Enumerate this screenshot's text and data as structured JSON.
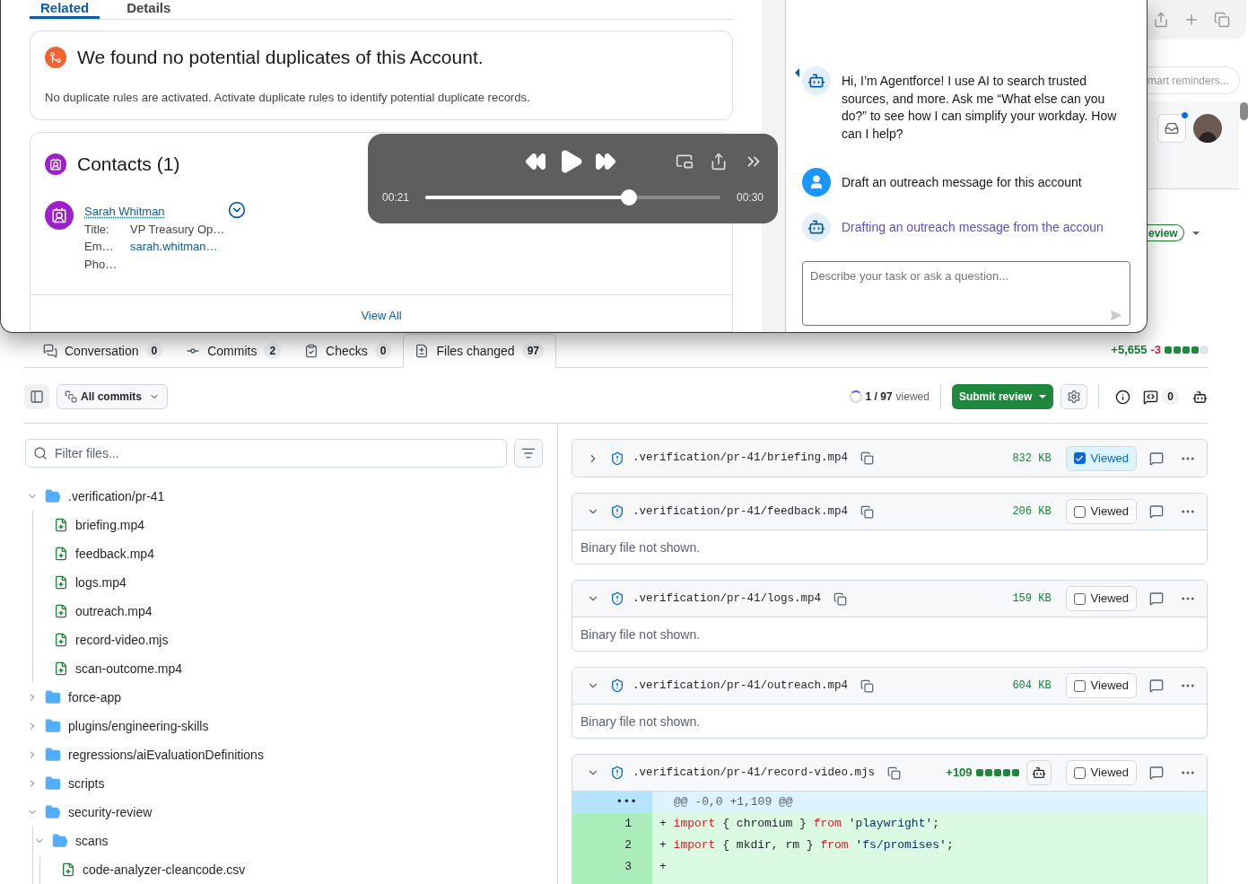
{
  "record_page": {
    "tabs": [
      {
        "label": "Related",
        "selected": true
      },
      {
        "label": "Details",
        "selected": false
      }
    ],
    "duplicates": {
      "title": "We found no potential duplicates of this Account.",
      "message": "No duplicate rules are activated. Activate duplicate rules to identify potential duplicate records."
    },
    "contacts": {
      "title": "Contacts (1)",
      "items": [
        {
          "name": "Sarah Whitman",
          "fields": [
            {
              "label": "Title:",
              "value": "VP Treasury Op…",
              "kind": "text"
            },
            {
              "label": "Em…",
              "value": "sarah.whitman…",
              "kind": "link"
            },
            {
              "label": "Pho…",
              "kind": "empty"
            }
          ]
        }
      ],
      "footer_link": "View All"
    }
  },
  "agent_panel": {
    "messages": [
      {
        "kind": "agent",
        "text": "Hi, I’m Agentforce! I use AI to search trusted sources, and more. Ask me “What else can you do?” to see how I can simplify your workday. How can I help?"
      },
      {
        "kind": "user",
        "text": "Draft an outreach message for this account"
      },
      {
        "kind": "agent_working",
        "text": "Drafting an outreach message from the accoun"
      }
    ],
    "input": {
      "placeholder": "Describe your task or ask a question..."
    }
  },
  "video_player": {
    "elapsed": "00:21",
    "duration": "00:30",
    "level": 0.69
  },
  "header_strip": {
    "search": {
      "placeholder": "mart reminders..."
    },
    "notifications": {
      "unread": true
    },
    "review_button": "eview"
  },
  "pr_tabs": [
    {
      "label": "Conversation",
      "count": "0",
      "selected": false
    },
    {
      "label": "Commits",
      "count": "2",
      "selected": false
    },
    {
      "label": "Checks",
      "count": "0",
      "selected": false
    },
    {
      "label": "Files changed",
      "count": "97",
      "selected": true
    }
  ],
  "diffstat": {
    "additions": "+5,655",
    "deletions": "-3",
    "blocks": [
      {
        "kind": "added"
      },
      {
        "kind": "added"
      },
      {
        "kind": "added"
      },
      {
        "kind": "added"
      },
      {
        "kind": "neutral"
      }
    ]
  },
  "toolbar": {
    "commits_menu": "All commits",
    "viewed_count": "1 / 97",
    "viewed_label": "viewed",
    "submit": "Submit review",
    "comments": "0"
  },
  "file_filter": {
    "placeholder": "Filter files..."
  },
  "file_tree": [
    {
      "kind": "folder",
      "name": ".verification/pr-41",
      "expanded": true,
      "children": [
        {
          "kind": "file",
          "name": "briefing.mp4"
        },
        {
          "kind": "file",
          "name": "feedback.mp4"
        },
        {
          "kind": "file",
          "name": "logs.mp4"
        },
        {
          "kind": "file",
          "name": "outreach.mp4"
        },
        {
          "kind": "file",
          "name": "record-video.mjs"
        },
        {
          "kind": "file",
          "name": "scan-outcome.mp4"
        }
      ]
    },
    {
      "kind": "folder",
      "name": "force-app",
      "expanded": false
    },
    {
      "kind": "folder",
      "name": "plugins/engineering-skills",
      "expanded": false
    },
    {
      "kind": "folder",
      "name": "regressions/aiEvaluationDefinitions",
      "expanded": false
    },
    {
      "kind": "folder",
      "name": "scripts",
      "expanded": false
    },
    {
      "kind": "folder",
      "name": "security-review",
      "expanded": true,
      "children": [
        {
          "kind": "folder",
          "name": "scans",
          "expanded": true,
          "children": [
            {
              "kind": "file",
              "name": "code-analyzer-cleancode.csv"
            }
          ]
        }
      ]
    }
  ],
  "diffs": [
    {
      "kind": "binary",
      "path": ".verification/pr-41/briefing.mp4",
      "size": "832 KB",
      "expanded": false,
      "viewed": true,
      "viewed_label": "Viewed"
    },
    {
      "kind": "binary",
      "path": ".verification/pr-41/feedback.mp4",
      "size": "206 KB",
      "expanded": true,
      "viewed": false,
      "viewed_label": "Viewed",
      "message": "Binary file not shown."
    },
    {
      "kind": "binary",
      "path": ".verification/pr-41/logs.mp4",
      "size": "159 KB",
      "expanded": true,
      "viewed": false,
      "viewed_label": "Viewed",
      "message": "Binary file not shown."
    },
    {
      "kind": "binary",
      "path": ".verification/pr-41/outreach.mp4",
      "size": "604 KB",
      "expanded": true,
      "viewed": false,
      "viewed_label": "Viewed",
      "message": "Binary file not shown."
    },
    {
      "kind": "code",
      "path": ".verification/pr-41/record-video.mjs",
      "additions": "+109",
      "blocks": [
        {
          "kind": "added"
        },
        {
          "kind": "added"
        },
        {
          "kind": "added"
        },
        {
          "kind": "added"
        },
        {
          "kind": "added"
        }
      ],
      "expanded": true,
      "viewed": false,
      "viewed_label": "Viewed",
      "hunk": {
        "expander": "•••",
        "header": "@@ -0,0 +1,109 @@"
      },
      "lines": [
        {
          "number": "1",
          "marker": "+",
          "tokens": [
            {
              "kind": "kw",
              "text": "import"
            },
            {
              "kind": "plain",
              "text": " { chromium } "
            },
            {
              "kind": "kw",
              "text": "from"
            },
            {
              "kind": "str",
              "text": " 'playwright'"
            },
            {
              "kind": "plain",
              "text": ";"
            }
          ]
        },
        {
          "number": "2",
          "marker": "+",
          "tokens": [
            {
              "kind": "kw",
              "text": "import"
            },
            {
              "kind": "plain",
              "text": " { mkdir, rm } "
            },
            {
              "kind": "kw",
              "text": "from"
            },
            {
              "kind": "str",
              "text": " 'fs/promises'"
            },
            {
              "kind": "plain",
              "text": ";"
            }
          ]
        },
        {
          "number": "3",
          "marker": "+"
        }
      ]
    }
  ]
}
